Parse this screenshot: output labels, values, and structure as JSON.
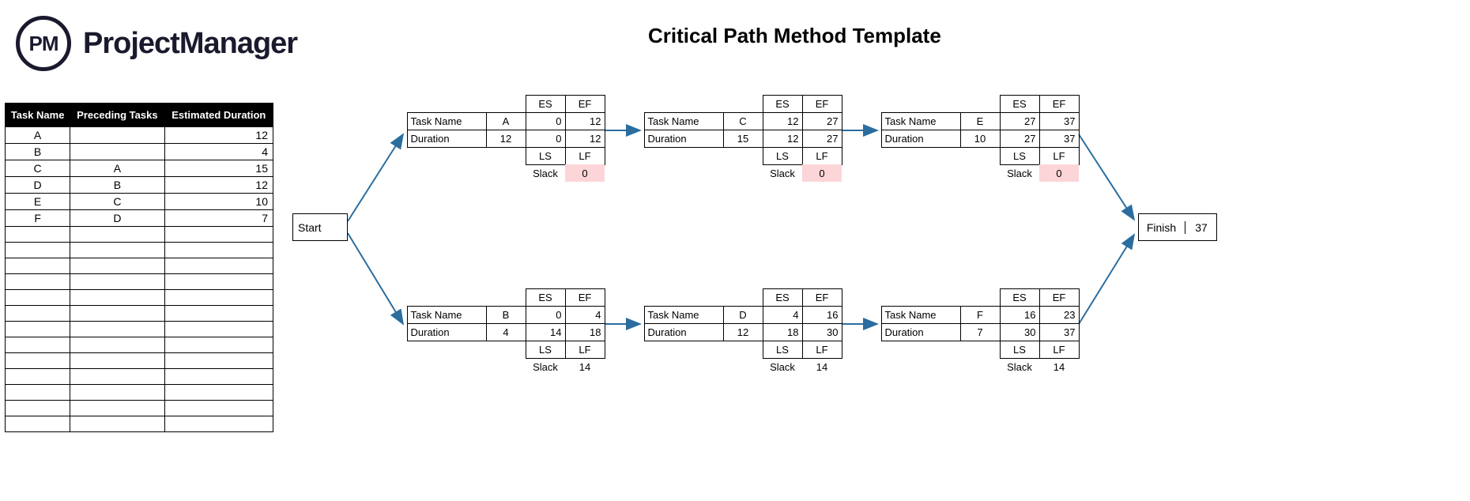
{
  "brand": {
    "logo": "PM",
    "name": "ProjectManager"
  },
  "title": "Critical Path Method Template",
  "table": {
    "headers": {
      "task": "Task Name",
      "pred": "Preceding Tasks",
      "dur": "Estimated Duration"
    },
    "rows": [
      {
        "task": "A",
        "pred": "",
        "dur": "12"
      },
      {
        "task": "B",
        "pred": "",
        "dur": "4"
      },
      {
        "task": "C",
        "pred": "A",
        "dur": "15"
      },
      {
        "task": "D",
        "pred": "B",
        "dur": "12"
      },
      {
        "task": "E",
        "pred": "C",
        "dur": "10"
      },
      {
        "task": "F",
        "pred": "D",
        "dur": "7"
      }
    ],
    "empty_rows": 13
  },
  "labels": {
    "start": "Start",
    "finish": "Finish",
    "taskname_label": "Task Name",
    "duration_label": "Duration",
    "es": "ES",
    "ef": "EF",
    "ls": "LS",
    "lf": "LF",
    "slack": "Slack"
  },
  "finish_value": "37",
  "nodes": {
    "A": {
      "name": "A",
      "dur": "12",
      "es": "0",
      "ef": "12",
      "ls": "0",
      "lf": "12",
      "slack": "0",
      "critical": true
    },
    "B": {
      "name": "B",
      "dur": "4",
      "es": "0",
      "ef": "4",
      "ls": "14",
      "lf": "18",
      "slack": "14",
      "critical": false
    },
    "C": {
      "name": "C",
      "dur": "15",
      "es": "12",
      "ef": "27",
      "ls": "12",
      "lf": "27",
      "slack": "0",
      "critical": true
    },
    "D": {
      "name": "D",
      "dur": "12",
      "es": "4",
      "ef": "16",
      "ls": "18",
      "lf": "30",
      "slack": "14",
      "critical": false
    },
    "E": {
      "name": "E",
      "dur": "10",
      "es": "27",
      "ef": "37",
      "ls": "27",
      "lf": "37",
      "slack": "0",
      "critical": true
    },
    "F": {
      "name": "F",
      "dur": "7",
      "es": "16",
      "ef": "23",
      "ls": "30",
      "lf": "37",
      "slack": "14",
      "critical": false
    }
  }
}
